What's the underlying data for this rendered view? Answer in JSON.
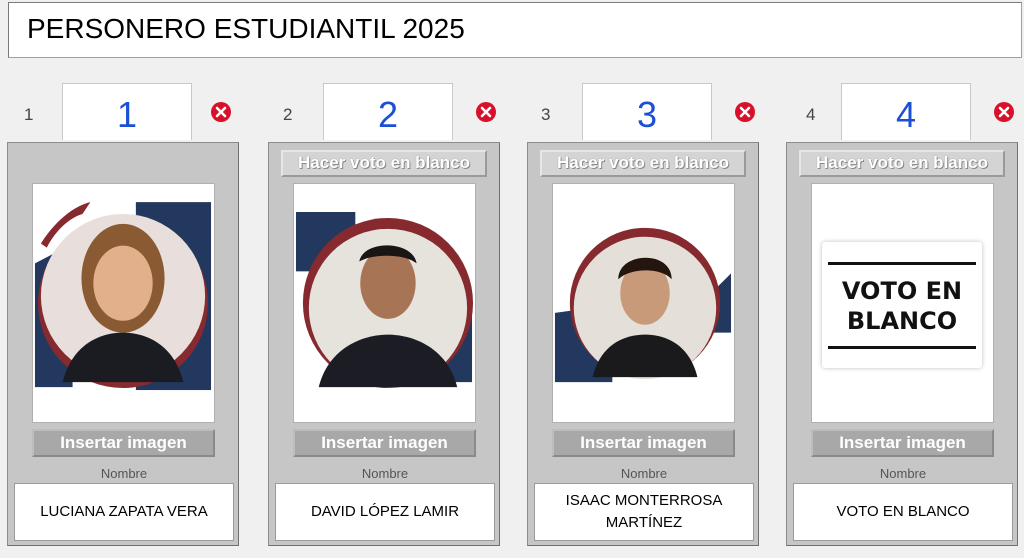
{
  "title": "PERSONERO ESTUDIANTIL 2025",
  "colors": {
    "number": "#1a4fd6",
    "delete": "#d8102a",
    "navy": "#22385e",
    "maroon": "#862a2f"
  },
  "candidates": [
    {
      "index": "1",
      "number": "1",
      "blank_button": "",
      "insert_button": "Insertar imagen",
      "name_label": "Nombre",
      "name": "LUCIANA ZAPATA VERA",
      "photo": "candidate-photo"
    },
    {
      "index": "2",
      "number": "2",
      "blank_button": "Hacer voto en blanco",
      "insert_button": "Insertar imagen",
      "name_label": "Nombre",
      "name": "DAVID LÓPEZ LAMIR",
      "photo": "candidate-photo"
    },
    {
      "index": "3",
      "number": "3",
      "blank_button": "Hacer voto en blanco",
      "insert_button": "Insertar imagen",
      "name_label": "Nombre",
      "name": "ISAAC MONTERROSA MARTÍNEZ",
      "photo": "candidate-photo"
    },
    {
      "index": "4",
      "number": "4",
      "blank_button": "Hacer voto en blanco",
      "insert_button": "Insertar imagen",
      "name_label": "Nombre",
      "name": "VOTO EN BLANCO",
      "photo": "blank-vote-card",
      "blank_card_line1": "VOTO EN",
      "blank_card_line2": "BLANCO"
    }
  ]
}
